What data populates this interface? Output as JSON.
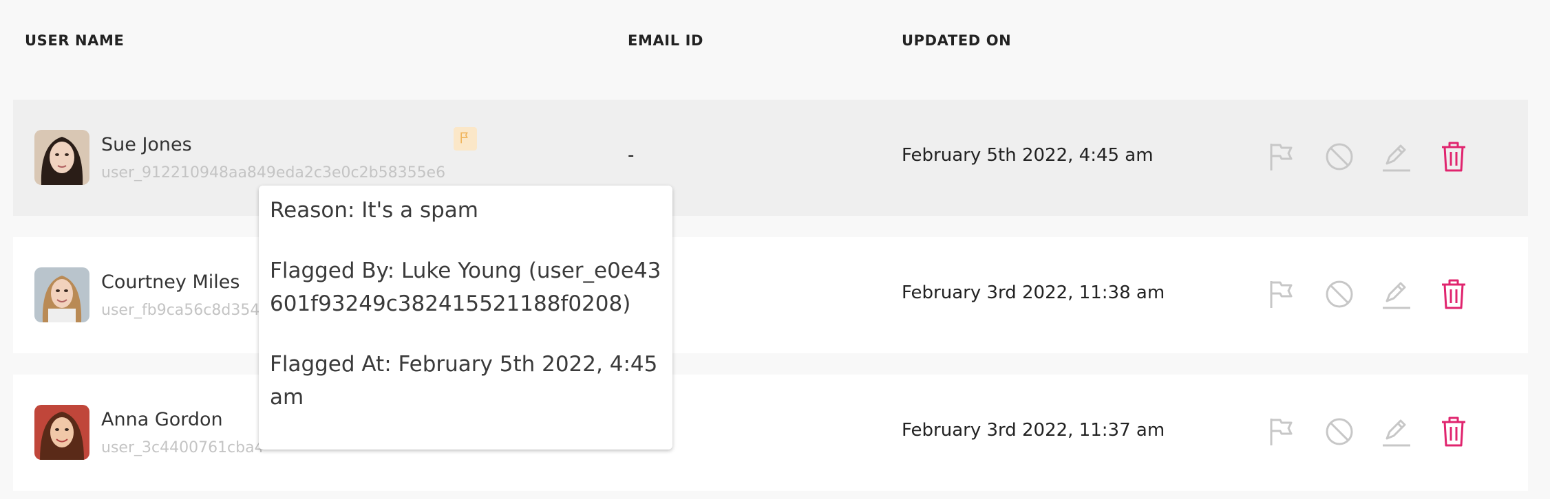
{
  "table": {
    "headers": {
      "user_name": "USER NAME",
      "email_id": "EMAIL ID",
      "updated_on": "UPDATED ON"
    },
    "rows": [
      {
        "name": "Sue Jones",
        "user_id": "user_912210948aa849eda2c3e0c2b58355e6",
        "email": "-",
        "updated_on": "February 5th 2022, 4:45 am",
        "flagged": true
      },
      {
        "name": "Courtney Miles",
        "user_id": "user_fb9ca56c8d354",
        "email": "",
        "updated_on": "February 3rd 2022, 11:38 am",
        "flagged": false
      },
      {
        "name": "Anna Gordon",
        "user_id": "user_3c4400761cba4",
        "email": "",
        "updated_on": "February 3rd 2022, 11:37 am",
        "flagged": false
      }
    ]
  },
  "tooltip": {
    "reason": "Reason: It's a spam",
    "flagged_by": "Flagged By: Luke Young (user_e0e43601f93249c382415521188f0208)",
    "flagged_at": "Flagged At: February 5th 2022, 4:45 am"
  },
  "colors": {
    "delete_icon": "#e0246e",
    "muted_icon": "#c7c7c7",
    "flag_badge_bg": "#fbe7c8",
    "flag_badge_icon": "#f0b55c"
  },
  "icons": {
    "flag": "flag-icon",
    "block": "block-icon",
    "edit": "pencil-icon",
    "delete": "trash-icon"
  }
}
